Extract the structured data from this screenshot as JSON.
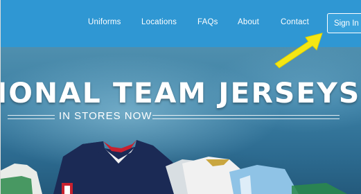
{
  "nav": {
    "items": [
      "Uniforms",
      "Locations",
      "FAQs",
      "About",
      "Contact"
    ],
    "sign_in_label": "Sign In"
  },
  "hero": {
    "title": "IONAL TEAM JERSEYS",
    "subtitle": "IN STORES NOW"
  },
  "colors": {
    "nav_background": "#2f97d3",
    "annotation_arrow": "#f5e614"
  },
  "icons": [
    "yellow-pointer-arrow-icon"
  ]
}
